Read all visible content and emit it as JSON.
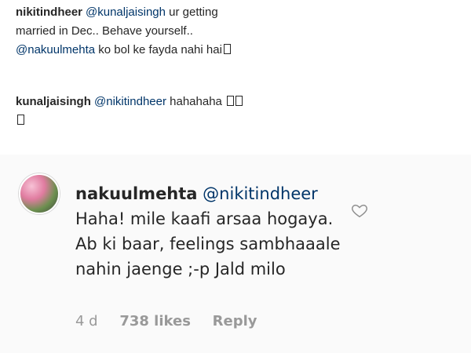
{
  "comment1": {
    "username": "nikitindheer",
    "mention1": "@kunaljaisingh",
    "text1": "ur getting",
    "text2": "married in Dec.. Behave yourself..",
    "mention2": "@nakuulmehta",
    "text3": "ko bol ke fayda nahi hai"
  },
  "comment2": {
    "username": "kunaljaisingh",
    "mention": "@nikitindheer",
    "text": "hahahaha"
  },
  "reply": {
    "username": "nakuulmehta",
    "mention": "@nikitindheer",
    "line1": "Haha! mile kaafi arsaa hogaya.",
    "line2": "Ab ki baar, feelings sambhaaale",
    "line3": "nahin jaenge ;-p Jald milo",
    "time": "4 d",
    "likes": "738 likes",
    "reply_label": "Reply",
    "like_icon": "heart-icon"
  }
}
